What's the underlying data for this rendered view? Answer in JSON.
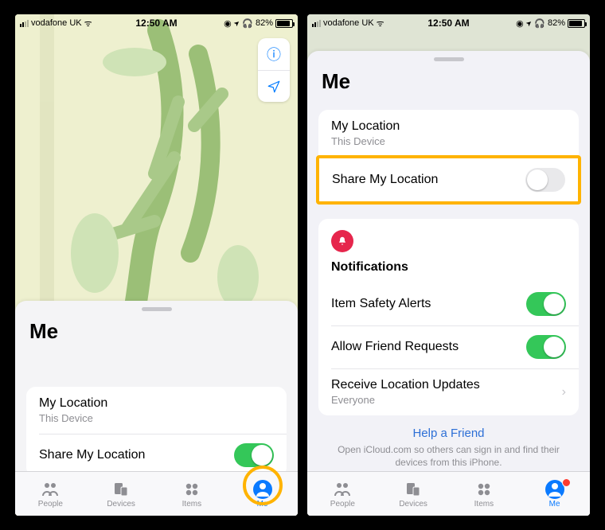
{
  "status": {
    "carrier": "vodafone UK",
    "wifi_glyph": "ᯤ",
    "time": "12:50 AM",
    "dnd_glyph": "◉",
    "lock_glyph": "🔒",
    "location_glyph": "➤",
    "headphones_glyph": "🎧",
    "battery_pct": "82%",
    "battery_fill_pct": 82
  },
  "map_controls": {
    "info_glyph": "ⓘ",
    "locate_glyph": "➤"
  },
  "left": {
    "sheet_title": "Me",
    "my_location_label": "My Location",
    "my_location_sub": "This Device",
    "share_label": "Share My Location",
    "share_on": true
  },
  "right": {
    "sheet_title": "Me",
    "my_location_label": "My Location",
    "my_location_sub": "This Device",
    "share_label": "Share My Location",
    "share_on": false,
    "notifications_heading": "Notifications",
    "item_safety_label": "Item Safety Alerts",
    "item_safety_on": true,
    "allow_friend_label": "Allow Friend Requests",
    "allow_friend_on": true,
    "receive_updates_label": "Receive Location Updates",
    "receive_updates_sub": "Everyone",
    "help_link": "Help a Friend",
    "help_text": "Open iCloud.com so others can sign in and find their devices from this iPhone."
  },
  "tabs": {
    "people": "People",
    "devices": "Devices",
    "items": "Items",
    "me": "Me"
  },
  "colors": {
    "accent": "#0a7aff",
    "toggle_on": "#34c759",
    "highlight": "#ffb300",
    "badge": "#ff3b30",
    "notif_bell": "#e6264c"
  }
}
